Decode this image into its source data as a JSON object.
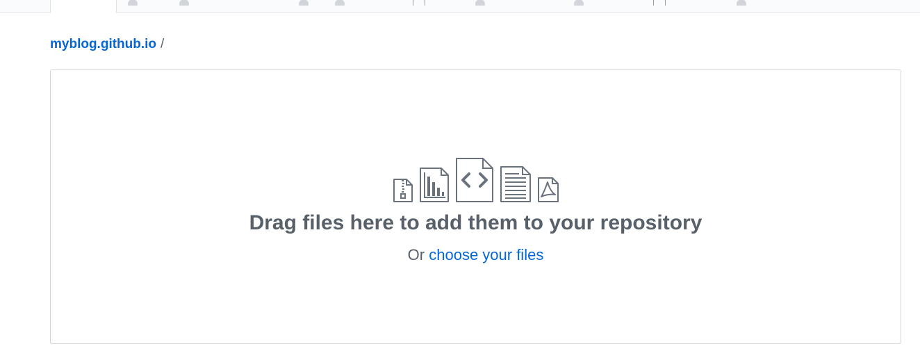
{
  "breadcrumb": {
    "repo_link": "myblog.github.io",
    "separator": "/"
  },
  "dropzone": {
    "title": "Drag files here to add them to your repository",
    "subtitle_prefix": "Or",
    "choose_files_link": "choose your files",
    "file_type_icons": [
      "zip-file-icon",
      "chart-file-icon",
      "code-file-icon",
      "text-file-icon",
      "pdf-file-icon"
    ]
  },
  "colors": {
    "link": "#0366d6",
    "muted_text": "#586069",
    "icon_stroke": "#6a737d",
    "border": "#d1d5da"
  }
}
